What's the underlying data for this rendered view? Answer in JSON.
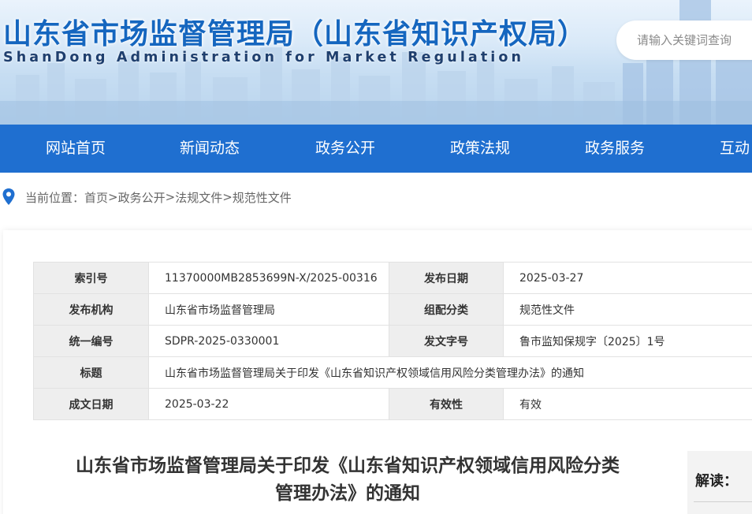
{
  "header": {
    "title": "山东省市场监督管理局（山东省知识产权局）",
    "subtitle": "ShanDong Administration for Market Regulation",
    "search_placeholder": "请输入关键词查询"
  },
  "nav": {
    "items": [
      "网站首页",
      "新闻动态",
      "政务公开",
      "政策法规",
      "政务服务",
      "互动"
    ]
  },
  "breadcrumb": {
    "prefix": "当前位置：",
    "items": [
      "首页",
      "政务公开",
      "法规文件",
      "规范性文件"
    ],
    "separator": ">"
  },
  "meta": {
    "rows": [
      {
        "label1": "索引号",
        "value1": "11370000MB2853699N-X/2025-00316",
        "label2": "发布日期",
        "value2": "2025-03-27"
      },
      {
        "label1": "发布机构",
        "value1": "山东省市场监督管理局",
        "label2": "组配分类",
        "value2": "规范性文件"
      },
      {
        "label1": "统一编号",
        "value1": "SDPR-2025-0330001",
        "label2": "发文字号",
        "value2": "鲁市监知保规字〔2025〕1号"
      },
      {
        "label1": "标题",
        "value1": "山东省市场监督管理局关于印发《山东省知识产权领域信用风险分类管理办法》的通知"
      },
      {
        "label1": "成文日期",
        "value1": "2025-03-22",
        "label2": "有效性",
        "value2": "有效"
      }
    ]
  },
  "article": {
    "title_line1": "山东省市场监督管理局关于印发《山东省知识产权领域信用风险分类",
    "title_line2": "管理办法》的通知"
  },
  "sidebar": {
    "interpretation_label": "解读："
  },
  "colors": {
    "brand_blue": "#1f6fd0",
    "title_blue": "#1566bf",
    "label_bg": "#eeeeee"
  },
  "icons": {
    "location": "map-pin-icon"
  }
}
